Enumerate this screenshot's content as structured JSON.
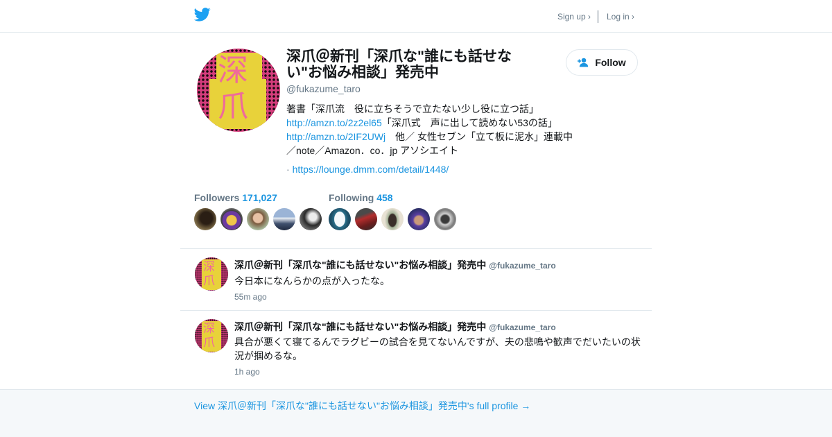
{
  "nav": {
    "signup": "Sign up ›",
    "login": "Log in ›"
  },
  "profile": {
    "name": "深爪＠新刊「深爪な\"誰にも話せない\"お悩み相談」発売中",
    "handle": "@fukazume_taro",
    "follow_label": "Follow",
    "avatar_text": [
      "深",
      "爪"
    ],
    "bio_parts": [
      "著書「深爪流　役に立ちそうで立たない少し役に立つ話」　",
      "http://amzn.to/2z2el65",
      "「深爪式　声に出して読めない53の話」",
      "http://amzn.to/2IF2UWj",
      "　他／ 女性セブン「立て板に泥水」連載中／note／Amazon．co．jp アソシエイト"
    ],
    "url_prefix": "· ",
    "url": "https://lounge.dmm.com/detail/1448/"
  },
  "stats": {
    "followers_label": "Followers",
    "followers_count": "171,027",
    "following_label": "Following",
    "following_count": "458"
  },
  "tweets": [
    {
      "author": "深爪＠新刊「深爪な\"誰にも話せない\"お悩み相談」発売中",
      "handle": "@fukazume_taro",
      "text": "今日本になんらかの点が入ったな。",
      "time": "55m ago"
    },
    {
      "author": "深爪＠新刊「深爪な\"誰にも話せない\"お悩み相談」発売中",
      "handle": "@fukazume_taro",
      "text": "具合が悪くて寝てるんでラグビーの試合を見てないんですが、夫の悲鳴や歓声でだいたいの状況が掴めるな。",
      "time": "1h ago"
    }
  ],
  "footer": {
    "link": "View 深爪＠新刊「深爪な\"誰にも話せない\"お悩み相談」発売中's full profile →"
  },
  "colors": {
    "accent": "#1b95e0",
    "muted": "#657786",
    "twitter_blue": "#1da1f2"
  }
}
